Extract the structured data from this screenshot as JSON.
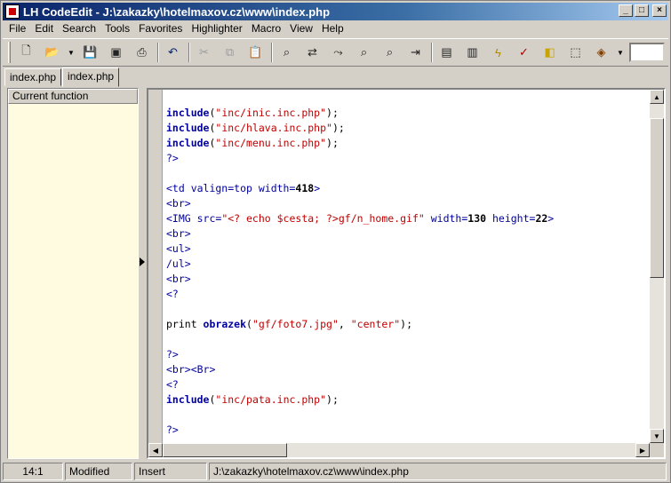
{
  "window": {
    "title": "LH CodeEdit - J:\\zakazky\\hotelmaxov.cz\\www\\index.php",
    "controls": [
      "minimize",
      "maximize",
      "close"
    ]
  },
  "menu": [
    {
      "label": "File"
    },
    {
      "label": "Edit"
    },
    {
      "label": "Search"
    },
    {
      "label": "Tools"
    },
    {
      "label": "Favorites"
    },
    {
      "label": "Highlighter"
    },
    {
      "label": "Macro"
    },
    {
      "label": "View"
    },
    {
      "label": "Help"
    }
  ],
  "toolbar": {
    "icons": [
      "new-file-icon",
      "open-folder-icon",
      "save-icon",
      "save-all-icon",
      "print-icon",
      "undo-icon",
      "cut-icon",
      "copy-icon",
      "paste-icon",
      "find-icon",
      "replace-icon",
      "find-next-icon",
      "find-in-files-icon",
      "find-prev-icon",
      "goto-icon",
      "document-icon",
      "columns-icon",
      "lightning-icon",
      "check-icon",
      "highlight-icon",
      "dotted-box-icon",
      "package-icon"
    ]
  },
  "tabs": [
    {
      "label": "index.php",
      "active": false
    },
    {
      "label": "index.php",
      "active": true
    }
  ],
  "side_panel": {
    "header": "Current function"
  },
  "editor": {
    "lines": [
      [
        {
          "t": "kw",
          "v": "include"
        },
        {
          "t": "plain",
          "v": "("
        },
        {
          "t": "str",
          "v": "\"inc/inic.inc.php\""
        },
        {
          "t": "plain",
          "v": ");"
        }
      ],
      [
        {
          "t": "kw",
          "v": "include"
        },
        {
          "t": "plain",
          "v": "("
        },
        {
          "t": "str",
          "v": "\"inc/hlava.inc.php\""
        },
        {
          "t": "plain",
          "v": ");"
        }
      ],
      [
        {
          "t": "kw",
          "v": "include"
        },
        {
          "t": "plain",
          "v": "("
        },
        {
          "t": "str",
          "v": "\"inc/menu.inc.php\""
        },
        {
          "t": "plain",
          "v": ");"
        }
      ],
      [
        {
          "t": "tag",
          "v": "?>"
        }
      ],
      [],
      [
        {
          "t": "tag",
          "v": "<td valign=top width="
        },
        {
          "t": "num",
          "v": "418"
        },
        {
          "t": "tag",
          "v": ">"
        }
      ],
      [
        {
          "t": "tag",
          "v": "<br>"
        }
      ],
      [
        {
          "t": "tag",
          "v": "<IMG src="
        },
        {
          "t": "str",
          "v": "\"<? echo $cesta; ?>gf/n_home.gif\""
        },
        {
          "t": "tag",
          "v": " width="
        },
        {
          "t": "num",
          "v": "130"
        },
        {
          "t": "tag",
          "v": " height="
        },
        {
          "t": "num",
          "v": "22"
        },
        {
          "t": "tag",
          "v": ">"
        }
      ],
      [
        {
          "t": "tag",
          "v": "<br>"
        }
      ],
      [
        {
          "t": "tag",
          "v": "<ul>"
        }
      ],
      [
        {
          "t": "tag",
          "v": "/ul>"
        }
      ],
      [
        {
          "t": "tag",
          "v": "<br>"
        }
      ],
      [
        {
          "t": "tag",
          "v": "<?"
        }
      ],
      [],
      [
        {
          "t": "plain",
          "v": "print "
        },
        {
          "t": "kw",
          "v": "obrazek"
        },
        {
          "t": "plain",
          "v": "("
        },
        {
          "t": "str",
          "v": "\"gf/foto7.jpg\""
        },
        {
          "t": "plain",
          "v": ", "
        },
        {
          "t": "str",
          "v": "\"center\""
        },
        {
          "t": "plain",
          "v": ");"
        }
      ],
      [],
      [
        {
          "t": "tag",
          "v": "?>"
        }
      ],
      [
        {
          "t": "tag",
          "v": "<br><Br>"
        }
      ],
      [
        {
          "t": "tag",
          "v": "<?"
        }
      ],
      [
        {
          "t": "kw",
          "v": "include"
        },
        {
          "t": "plain",
          "v": "("
        },
        {
          "t": "str",
          "v": "\"inc/pata.inc.php\""
        },
        {
          "t": "plain",
          "v": ");"
        }
      ],
      [],
      [
        {
          "t": "tag",
          "v": "?>"
        }
      ]
    ]
  },
  "status": {
    "position": "14:1",
    "modified": "Modified",
    "mode": "Insert",
    "path": "J:\\zakazky\\hotelmaxov.cz\\www\\index.php"
  }
}
